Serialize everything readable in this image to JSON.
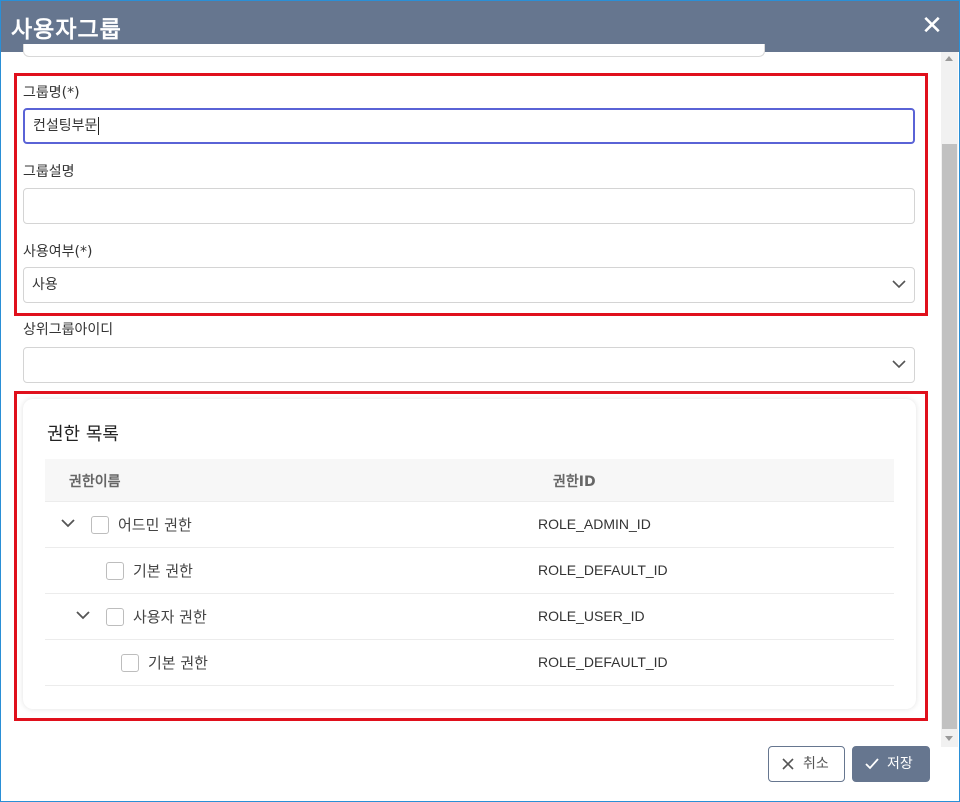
{
  "dialog": {
    "title": "사용자그룹",
    "close_icon": "close-icon"
  },
  "form": {
    "group_name": {
      "label": "그룹명(*)",
      "value": "컨설팅부문"
    },
    "group_desc": {
      "label": "그룹설명",
      "value": ""
    },
    "use_yn": {
      "label": "사용여부(*)",
      "selected": "사용"
    },
    "parent_group": {
      "label": "상위그룹아이디",
      "selected": ""
    }
  },
  "permissions": {
    "title": "권한 목록",
    "columns": [
      "권한이름",
      "권한ID"
    ],
    "rows": [
      {
        "name": "어드민 권한",
        "id": "ROLE_ADMIN_ID",
        "expanded": true,
        "checked": false
      },
      {
        "name": "기본 권한",
        "id": "ROLE_DEFAULT_ID",
        "checked": false
      },
      {
        "name": "사용자 권한",
        "id": "ROLE_USER_ID",
        "expanded": true,
        "checked": false
      },
      {
        "name": "기본 권한",
        "id": "ROLE_DEFAULT_ID",
        "checked": false
      }
    ]
  },
  "footer": {
    "cancel_label": "취소",
    "save_label": "저장"
  },
  "colors": {
    "header": "#66768f",
    "highlight": "#e0101c",
    "focus": "#5a63d6"
  }
}
